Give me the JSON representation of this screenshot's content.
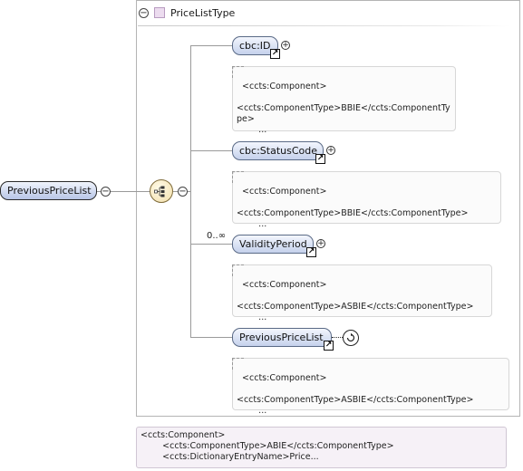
{
  "type": {
    "name": "PriceListType"
  },
  "root_element": {
    "label": "PreviousPriceList"
  },
  "elements": [
    {
      "label": "cbc:ID",
      "occurs": "",
      "annotation": "<ccts:Component>\n\n<ccts:ComponentType>BBIE</ccts:ComponentTy\npe>\n        ..."
    },
    {
      "label": "cbc:StatusCode",
      "occurs": "",
      "annotation": "<ccts:Component>\n\n<ccts:ComponentType>BBIE</ccts:ComponentType>\n        ..."
    },
    {
      "label": "ValidityPeriod",
      "occurs": "0..∞",
      "annotation": "<ccts:Component>\n\n<ccts:ComponentType>ASBIE</ccts:ComponentType>\n        ..."
    },
    {
      "label": "PreviousPriceList",
      "occurs": "",
      "annotation": "<ccts:Component>\n\n<ccts:ComponentType>ASBIE</ccts:ComponentType>\n        ..."
    }
  ],
  "root_annotation": "<ccts:Component>\n        <ccts:ComponentType>ABIE</ccts:ComponentType>\n        <ccts:DictionaryEntryName>Price...",
  "icons": {
    "collapse": "minus-circle-icon",
    "expand": "plus-circle-icon",
    "reference": "reference-arrow-icon",
    "sequence": "sequence-compositor-icon",
    "recursion": "recursion-icon"
  },
  "colors": {
    "pill_top": "#f3f6fd",
    "pill_bottom": "#c5d1ec",
    "type_swatch": "#ecdcef",
    "sequence_fill": "#f2deaa"
  }
}
